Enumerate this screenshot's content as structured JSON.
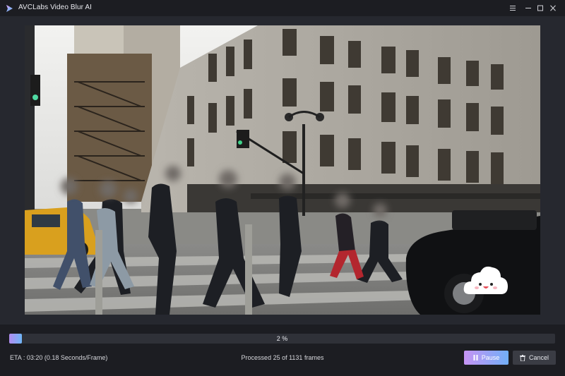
{
  "window": {
    "title": "AVCLabs Video Blur AI"
  },
  "progress": {
    "percent_value": 0.02,
    "label": "2 %"
  },
  "status": {
    "eta": "ETA : 03:20 (0.18 Seconds/Frame)",
    "processed": "Processed 25 of 1131 frames"
  },
  "buttons": {
    "pause_label": "Pause",
    "cancel_label": "Cancel"
  },
  "icons": {
    "app_logo": "play-logo-icon",
    "menu": "hamburger-menu-icon",
    "minimize": "minimize-icon",
    "maximize": "maximize-icon",
    "close": "close-icon",
    "pause": "pause-icon",
    "cancel": "trash-icon",
    "mascot": "cloud-mascot-icon"
  },
  "colors": {
    "accent_start": "#c694f4",
    "accent_end": "#71aef6",
    "background": "#1c1d22",
    "stage": "#26282f"
  }
}
